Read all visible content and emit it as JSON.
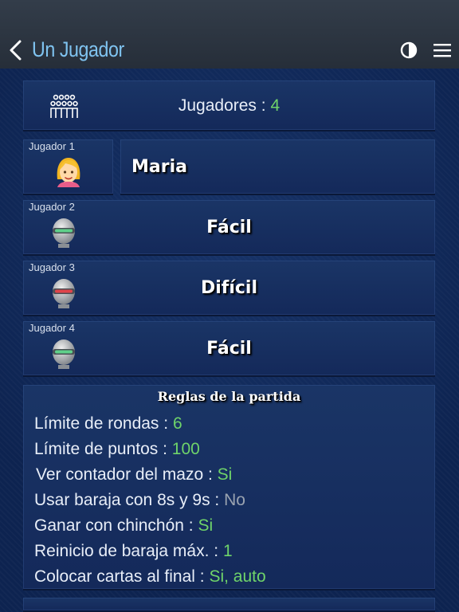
{
  "header": {
    "back_icon": "chevron-left-icon",
    "title": "Un Jugador",
    "contrast_icon": "contrast-icon",
    "menu_icon": "hamburger-menu-icon"
  },
  "players_count": {
    "icon": "group-of-people-icon",
    "label": "Jugadores : ",
    "value": "4"
  },
  "players": [
    {
      "label": "Jugador 1",
      "name": "Maria",
      "icon": "woman-avatar-icon"
    },
    {
      "label": "Jugador 2",
      "name": "Fácil",
      "icon": "robot-easy-icon"
    },
    {
      "label": "Jugador 3",
      "name": "Difícil",
      "icon": "robot-hard-icon"
    },
    {
      "label": "Jugador 4",
      "name": "Fácil",
      "icon": "robot-easy-icon"
    }
  ],
  "rules": {
    "title": "Reglas de la partida",
    "items": [
      {
        "label": "Límite de rondas : ",
        "value": "6"
      },
      {
        "label": "Límite de puntos : ",
        "value": "100"
      },
      {
        "label": "Ver contador del mazo : ",
        "value": "Si"
      },
      {
        "label": "Usar baraja con 8s y 9s : ",
        "value": "No"
      },
      {
        "label": "Ganar con chinchón : ",
        "value": "Si"
      },
      {
        "label": "Reinicio de baraja máx. : ",
        "value": "1"
      },
      {
        "label": "Colocar cartas al final : ",
        "value": "Si, auto"
      }
    ]
  },
  "colors": {
    "accent_title": "#7fc3f0",
    "value_green": "#6fd46a",
    "value_gray": "#9aa3b0",
    "panel": "#1a3566"
  }
}
